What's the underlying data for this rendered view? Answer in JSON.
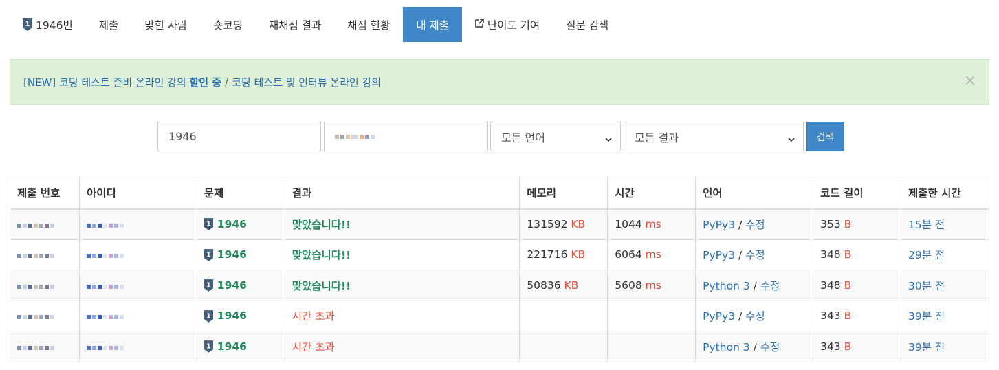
{
  "tabs": [
    {
      "label": "1946번",
      "icon": "tier-badge-icon"
    },
    {
      "label": "제출"
    },
    {
      "label": "맞힌 사람"
    },
    {
      "label": "숏코딩"
    },
    {
      "label": "재채점 결과"
    },
    {
      "label": "채점 현황"
    },
    {
      "label": "내 제출",
      "active": true
    },
    {
      "label": "난이도 기여",
      "icon": "external-link-icon"
    },
    {
      "label": "질문 검색"
    }
  ],
  "alert": {
    "part1": "[NEW] 코딩 테스트 준비 온라인 강의",
    "part2": "할인 중",
    "sep": "/",
    "part3": "코딩 테스트 및 인터뷰 온라인 강의",
    "close": "×"
  },
  "search": {
    "problem_id": "1946",
    "language": "모든 언어",
    "result": "모든 결과",
    "button": "검색"
  },
  "table": {
    "headers": [
      "제출 번호",
      "아이디",
      "문제",
      "결과",
      "메모리",
      "시간",
      "언어",
      "코드 길이",
      "제출한 시간"
    ],
    "rows": [
      {
        "problem": "1946",
        "result": "맞았습니다!!",
        "status": "ok",
        "memory": "131592",
        "memory_unit": "KB",
        "time": "1044",
        "time_unit": "ms",
        "lang": "PyPy3",
        "edit": "수정",
        "length": "353",
        "length_unit": "B",
        "when": "15분 전"
      },
      {
        "problem": "1946",
        "result": "맞았습니다!!",
        "status": "ok",
        "memory": "221716",
        "memory_unit": "KB",
        "time": "6064",
        "time_unit": "ms",
        "lang": "PyPy3",
        "edit": "수정",
        "length": "348",
        "length_unit": "B",
        "when": "29분 전"
      },
      {
        "problem": "1946",
        "result": "맞았습니다!!",
        "status": "ok",
        "memory": "50836",
        "memory_unit": "KB",
        "time": "5608",
        "time_unit": "ms",
        "lang": "Python 3",
        "edit": "수정",
        "length": "348",
        "length_unit": "B",
        "when": "30분 전"
      },
      {
        "problem": "1946",
        "result": "시간 초과",
        "status": "tle",
        "memory": "",
        "memory_unit": "",
        "time": "",
        "time_unit": "",
        "lang": "PyPy3",
        "edit": "수정",
        "length": "343",
        "length_unit": "B",
        "when": "39분 전"
      },
      {
        "problem": "1946",
        "result": "시간 초과",
        "status": "tle",
        "memory": "",
        "memory_unit": "",
        "time": "",
        "time_unit": "",
        "lang": "Python 3",
        "edit": "수정",
        "length": "343",
        "length_unit": "B",
        "when": "39분 전"
      }
    ]
  },
  "colors": {
    "accent": "#3f87c6",
    "success": "#1e8a5a",
    "danger": "#e74c3c",
    "link": "#2a6fb1",
    "alert_bg": "#dff0d8",
    "tier": "#435f7a"
  }
}
